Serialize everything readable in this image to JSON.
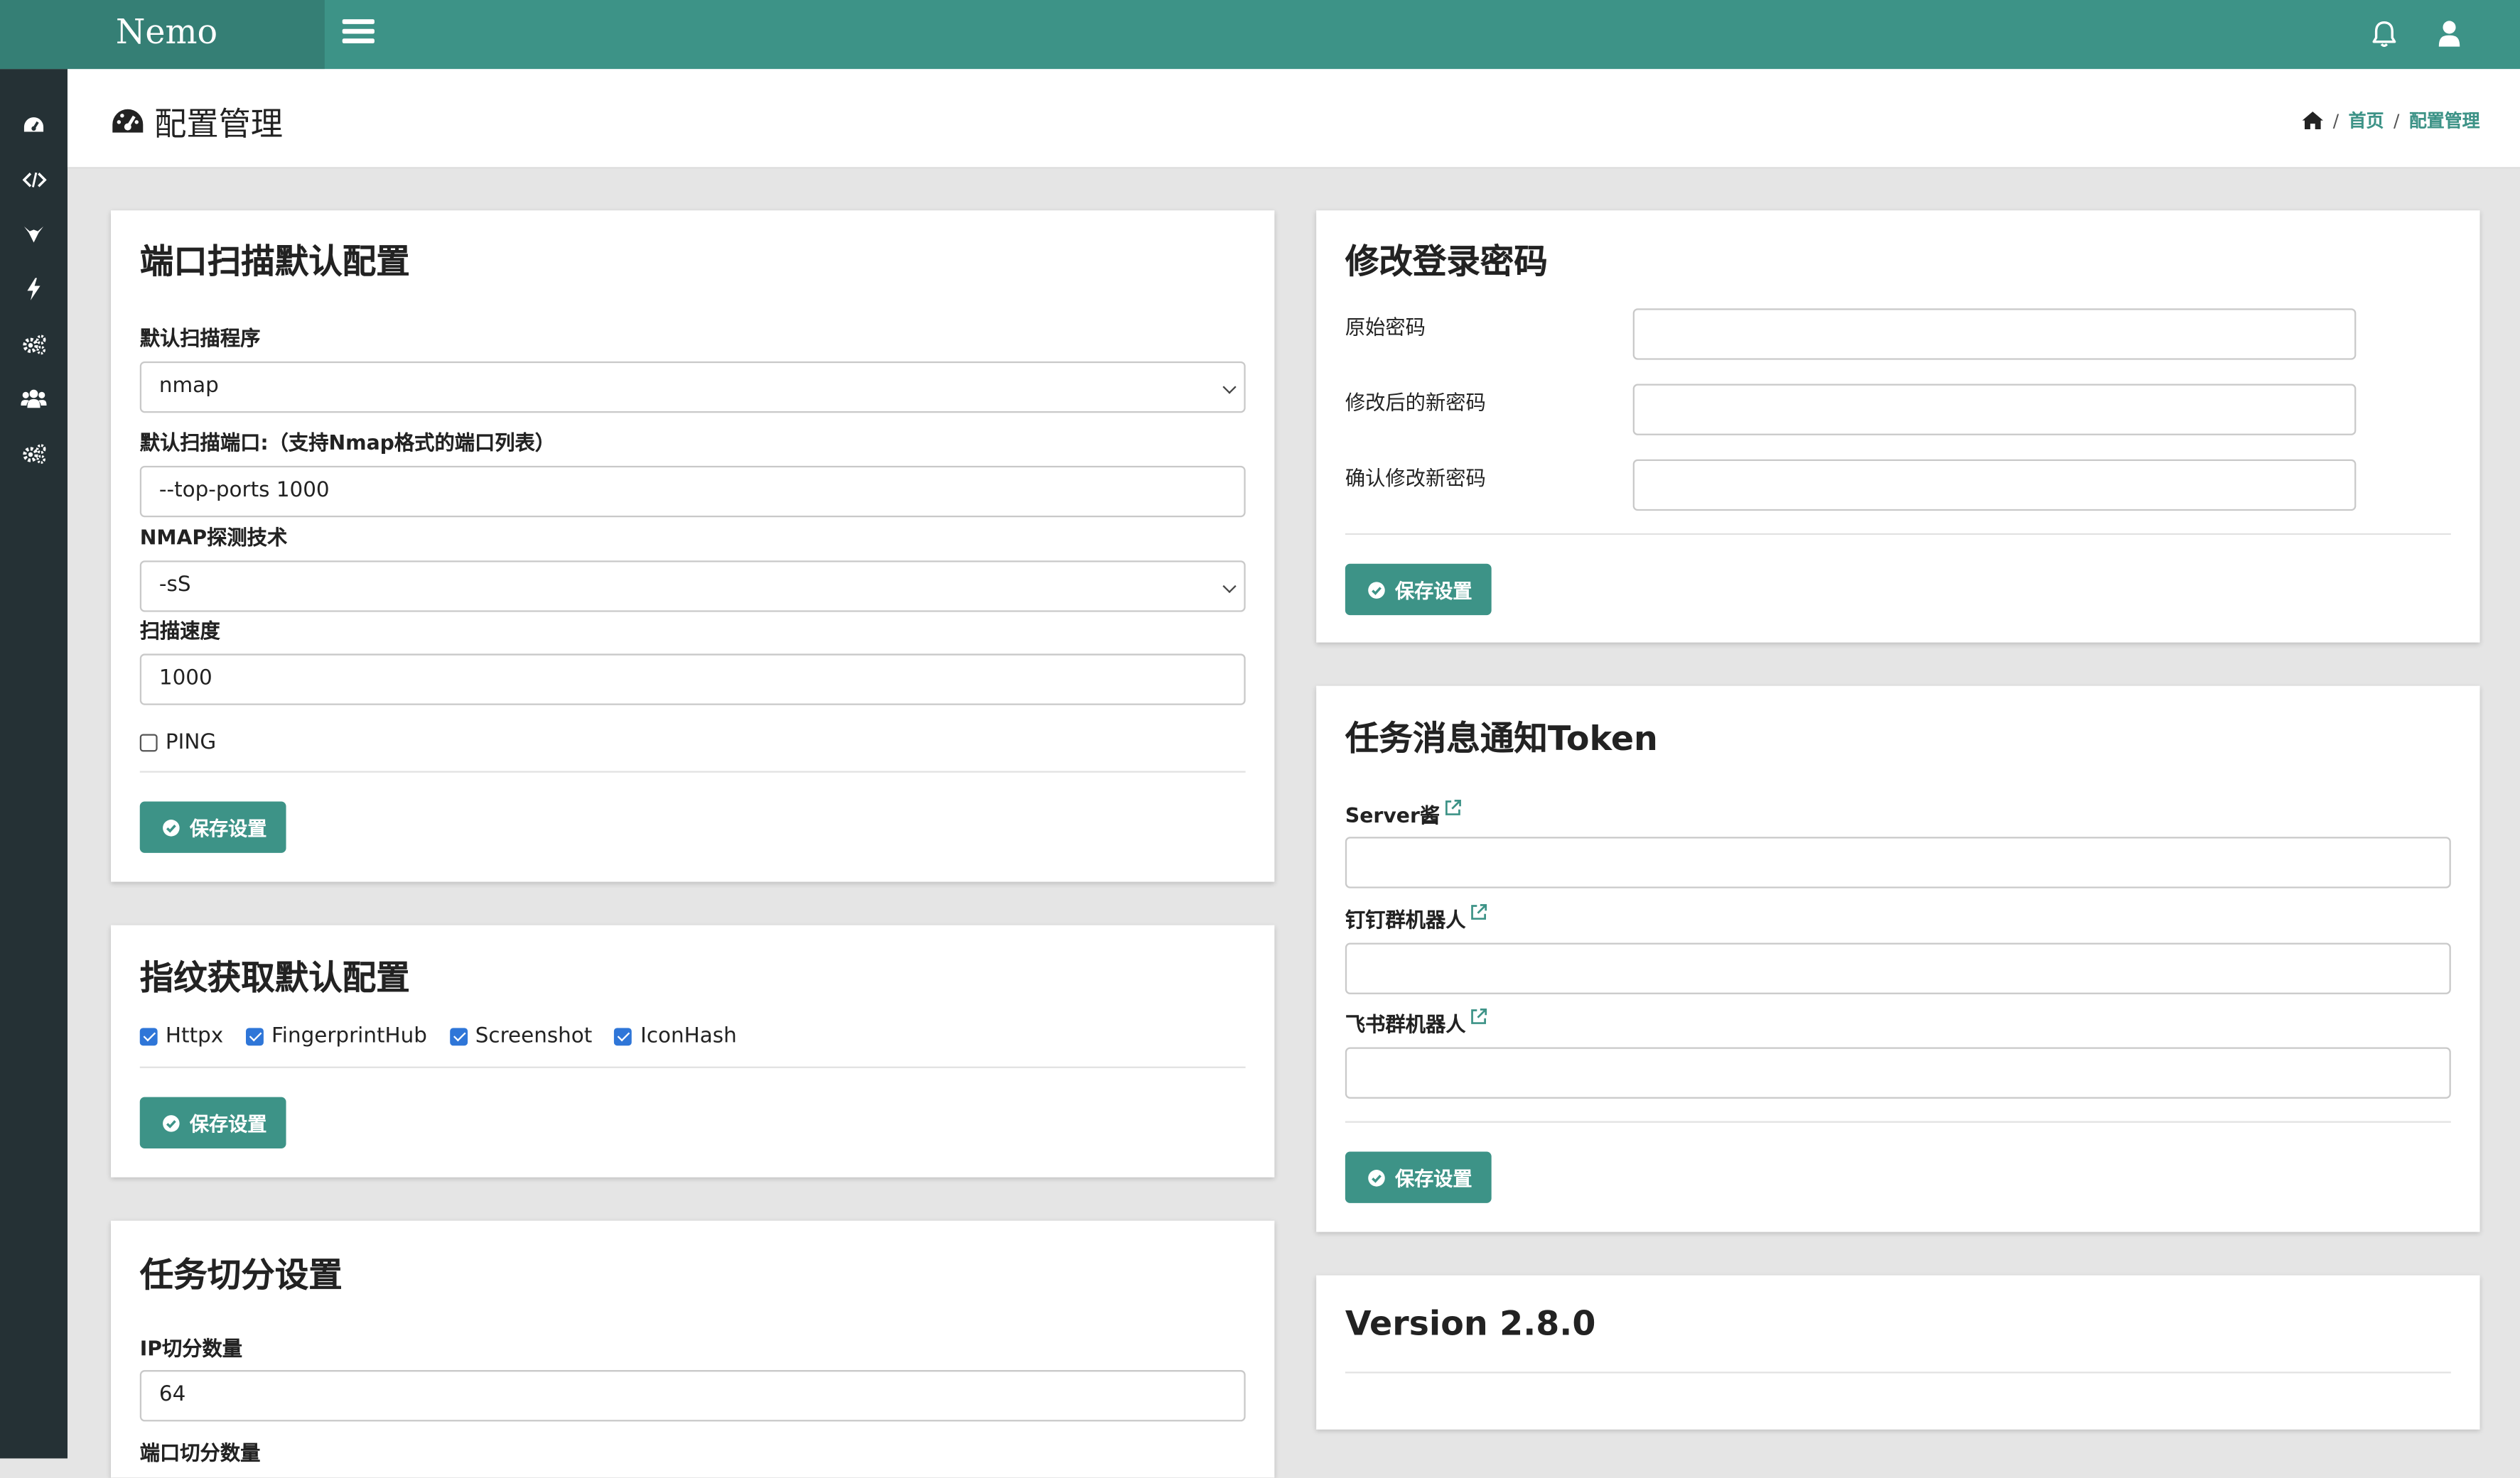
{
  "brand": "Nemo",
  "header": {
    "title": "配置管理",
    "breadcrumb": {
      "home": "首页",
      "current": "配置管理"
    }
  },
  "sidebar": {
    "items": [
      "dashboard-icon",
      "code-icon",
      "fox-icon",
      "bolt-icon",
      "cogs-icon",
      "users-icon",
      "cogs-icon"
    ]
  },
  "port_scan": {
    "title": "端口扫描默认配置",
    "program_label": "默认扫描程序",
    "program_value": "nmap",
    "port_label": "默认扫描端口:（支持Nmap格式的端口列表）",
    "port_value": "--top-ports 1000",
    "tech_label": "NMAP探测技术",
    "tech_value": "-sS",
    "speed_label": "扫描速度",
    "speed_value": "1000",
    "ping_label": "PING",
    "ping_checked": false,
    "save_label": "保存设置"
  },
  "fingerprint": {
    "title": "指纹获取默认配置",
    "options": [
      {
        "label": "Httpx",
        "checked": true
      },
      {
        "label": "FingerprintHub",
        "checked": true
      },
      {
        "label": "Screenshot",
        "checked": true
      },
      {
        "label": "IconHash",
        "checked": true
      }
    ],
    "save_label": "保存设置"
  },
  "task_split": {
    "title": "任务切分设置",
    "ip_label": "IP切分数量",
    "ip_value": "64",
    "port_label": "端口切分数量"
  },
  "password": {
    "title": "修改登录密码",
    "old_label": "原始密码",
    "new_label": "修改后的新密码",
    "confirm_label": "确认修改新密码",
    "save_label": "保存设置"
  },
  "notify": {
    "title": "任务消息通知Token",
    "server_label": "Server酱",
    "dingtalk_label": "钉钉群机器人",
    "feishu_label": "飞书群机器人",
    "save_label": "保存设置"
  },
  "version": {
    "text": "Version 2.8.0"
  },
  "colors": {
    "brand": "#3d9387",
    "sidebar": "#253135",
    "checkbox": "#2f76d8"
  }
}
